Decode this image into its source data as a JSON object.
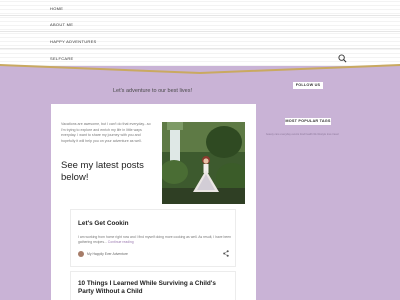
{
  "nav": {
    "items": [
      {
        "label": "HOME"
      },
      {
        "label": "ABOUT ME"
      },
      {
        "label": "HAPPY ADVENTURES"
      },
      {
        "label": "SELFCARE"
      }
    ]
  },
  "header": {
    "search_icon": "search-icon",
    "tagline": "Let's adventure to our best lives!"
  },
  "intro": {
    "text": "Vacations are awesome, but I can't do that everyday...so I'm trying to explore and enrich my life in little ways everyday. I want to share my journey with you and hopefully it will help you on your adventure as well.",
    "heading": "See my latest posts below!"
  },
  "posts": [
    {
      "title": "Let's Get Cookin",
      "excerpt": "I am working from home right now and I find myself doing more cooking as well. As result, I have been gathering recipes...",
      "continue_label": "Continue reading",
      "author": "My Happily Ever Adventure"
    },
    {
      "title": "10 Things I Learned While Surviving a Child's Party Without a Child"
    }
  ],
  "sidebar": {
    "follow_label": "FOLLOW US",
    "tags_label": "MOST POPULAR TAGS",
    "tags_text": "beauty care everyday events food health life lifestyle love travel"
  },
  "colors": {
    "background": "#c9b3d6",
    "accent_gold": "#c9a961",
    "link": "#9b7ab0"
  }
}
